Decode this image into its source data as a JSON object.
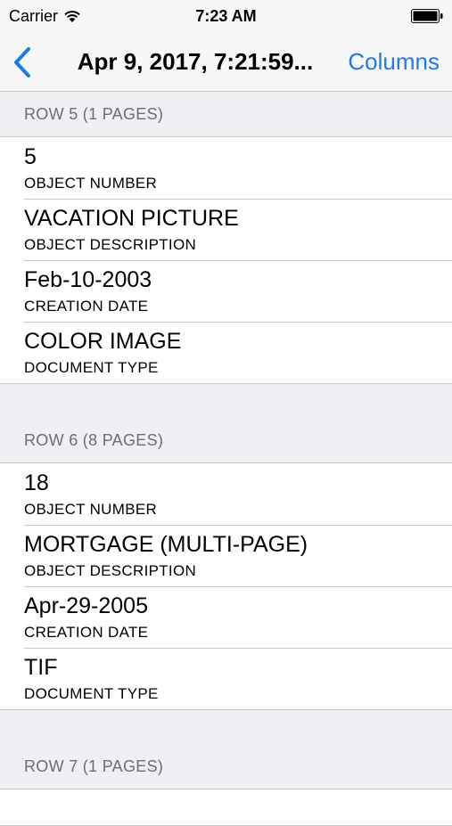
{
  "status_bar": {
    "carrier": "Carrier",
    "time": "7:23 AM",
    "wifi_icon": "wifi-icon",
    "battery_icon": "battery-full-icon"
  },
  "nav": {
    "back_icon": "chevron-left-icon",
    "title": "Apr 9, 2017, 7:21:59...",
    "columns_label": "Columns",
    "accent_color": "#1a7cf5"
  },
  "sections": [
    {
      "header": "ROW 5 (1 PAGES)",
      "cells": [
        {
          "value": "5",
          "label": "OBJECT NUMBER"
        },
        {
          "value": "VACATION PICTURE",
          "label": "OBJECT DESCRIPTION"
        },
        {
          "value": "Feb-10-2003",
          "label": "CREATION DATE"
        },
        {
          "value": "COLOR IMAGE",
          "label": "DOCUMENT TYPE"
        }
      ]
    },
    {
      "header": "ROW 6 (8 PAGES)",
      "cells": [
        {
          "value": "18",
          "label": "OBJECT NUMBER"
        },
        {
          "value": "MORTGAGE (MULTI-PAGE)",
          "label": "OBJECT DESCRIPTION"
        },
        {
          "value": "Apr-29-2005",
          "label": "CREATION DATE"
        },
        {
          "value": "TIF",
          "label": "DOCUMENT TYPE"
        }
      ]
    },
    {
      "header": "ROW 7 (1 PAGES)",
      "cells": []
    }
  ]
}
